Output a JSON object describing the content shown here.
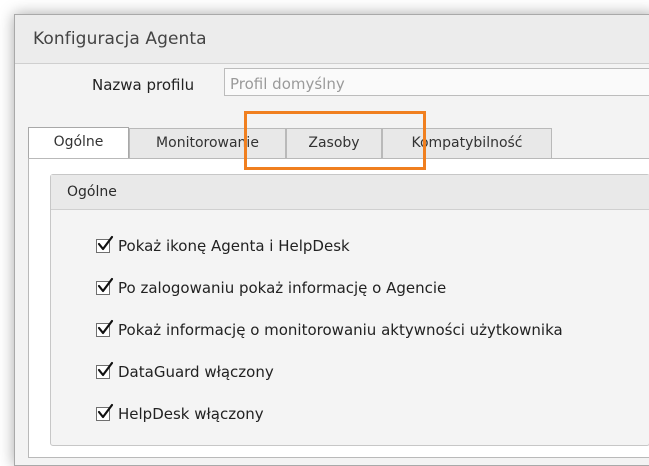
{
  "window": {
    "title": "Konfiguracja Agenta"
  },
  "profile": {
    "label": "Nazwa profilu",
    "value": "Profil domyślny"
  },
  "tabs": [
    {
      "label": "Ogólne",
      "active": true
    },
    {
      "label": "Monitorowanie",
      "active": false
    },
    {
      "label": "Zasoby",
      "active": false
    },
    {
      "label": "Kompatybilność",
      "active": false
    }
  ],
  "group": {
    "title": "Ogólne",
    "options": [
      {
        "label": "Pokaż ikonę Agenta i HelpDesk",
        "checked": true
      },
      {
        "label": "Po zalogowaniu pokaż informację o Agencie",
        "checked": true
      },
      {
        "label": "Pokaż informację o monitorowaniu aktywności użytkownika",
        "checked": true
      },
      {
        "label": "DataGuard włączony",
        "checked": true
      },
      {
        "label": "HelpDesk włączony",
        "checked": true
      }
    ]
  },
  "colors": {
    "highlight": "#f07f1f",
    "window_background": "#f3f3f3",
    "group_background": "#f4f4f4"
  },
  "icons": {
    "checkbox_mark": "checkmark-icon"
  }
}
